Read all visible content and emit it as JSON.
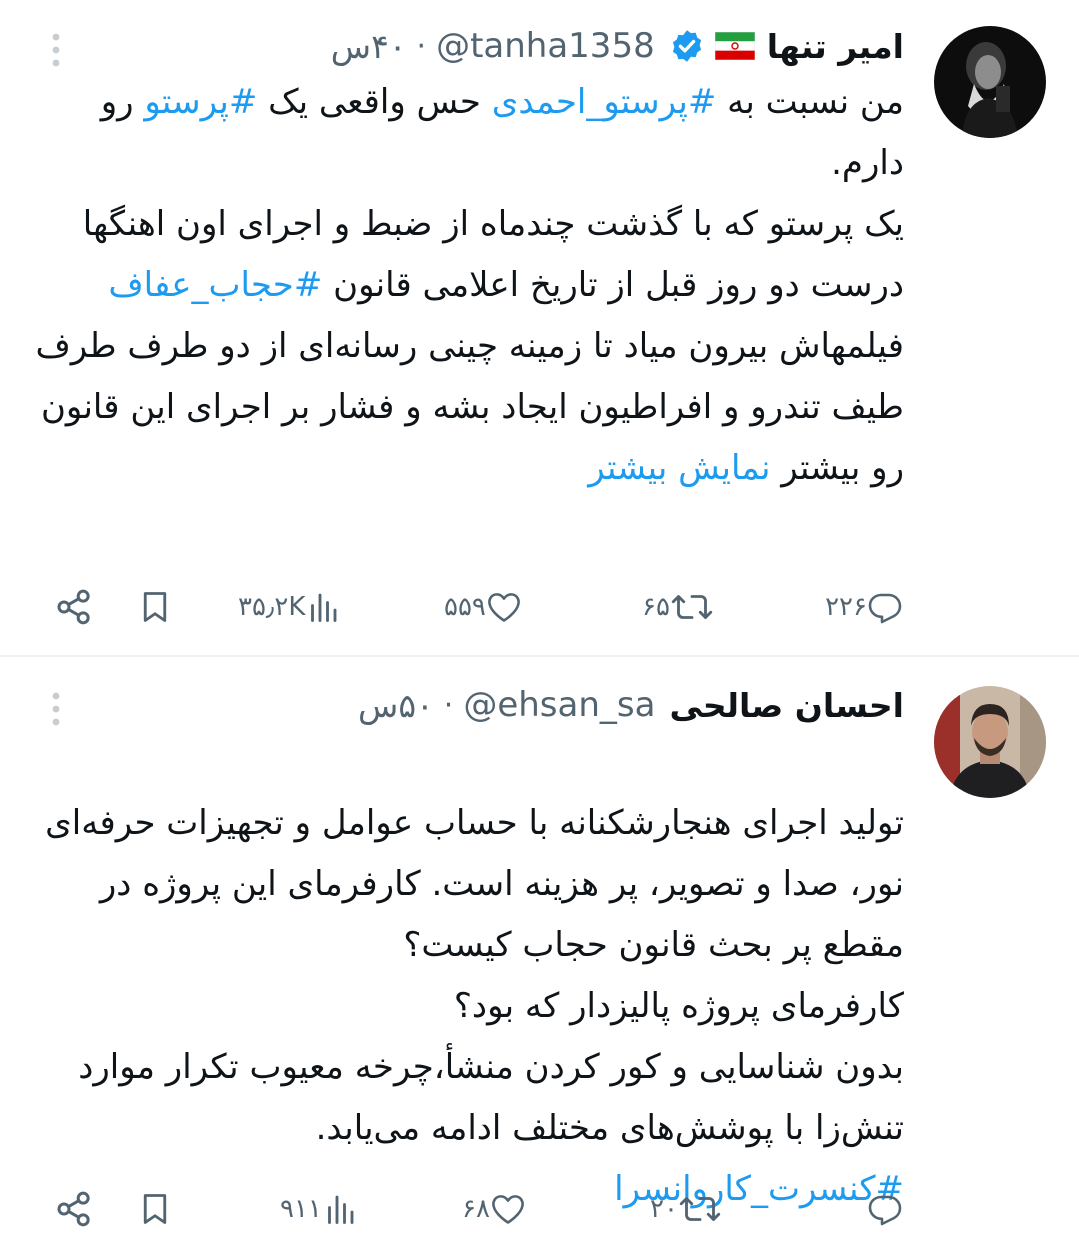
{
  "tweets": [
    {
      "name": "امیر تنها",
      "handle": "@tanha1358",
      "separator": "·",
      "time": "۴۰س",
      "text_parts": [
        {
          "t": "من نسبت به ",
          "link": false
        },
        {
          "t": "#پرستو_احمدی",
          "link": true
        },
        {
          "t": " حس واقعی یک ",
          "link": false
        },
        {
          "t": "#پرستو",
          "link": true
        },
        {
          "t": " رو دارم.",
          "link": false
        },
        {
          "t": "\nیک پرستو که با گذشت چندماه از ضبط و اجرای اون اهنگها درست دو روز قبل از تاریخ اعلامی قانون ",
          "link": false
        },
        {
          "t": "#حجاب_عفاف",
          "link": true
        },
        {
          "t": " فیلمهاش بیرون میاد تا زمینه چینی رسانه‌ای از دو طرف طرف طیف تندرو و  افراطیون ایجاد بشه و فشار بر اجرای این قانون رو بیشتر ",
          "link": false
        },
        {
          "t": "نمایش بیشتر",
          "link": true
        }
      ],
      "stats": {
        "replies": "۲۲۶",
        "retweets": "۶۵",
        "likes": "۵۵۹",
        "views": "۳۵٫۲K"
      },
      "icons": {
        "avatar": "avatar-dark-portrait",
        "flag": "iran-flag-icon",
        "verified": "verified-badge-icon",
        "more": "more-options-icon",
        "reply": "reply-icon",
        "retweet": "retweet-icon",
        "like": "like-icon",
        "views": "views-icon",
        "bookmark": "bookmark-icon",
        "share": "share-icon"
      }
    },
    {
      "name": "احسان صالحی",
      "handle": "@ehsan_sa",
      "separator": "·",
      "time": "۵۰س",
      "text_parts": [
        {
          "t": "تولید اجرای هنجارشکنانه با حساب عوامل و تجهیزات حرفه‌ای نور، صدا و تصویر، پر هزینه است. کارفرمای این پروژه در مقطع پر بحث قانون حجاب کیست؟\nکارفرمای پروژه پالیزدار که بود؟\nبدون شناسایی و کور کردن منشأ،چرخه معیوب تکرار موارد تنش‌زا با پوشش‌های مختلف ادامه می‌یابد.\n",
          "link": false
        },
        {
          "t": "#کنسرت_کاروانسرا",
          "link": true
        }
      ],
      "stats": {
        "replies": "",
        "retweets": "۲۰",
        "likes": "۶۸",
        "views": "۹۱۱"
      },
      "icons": {
        "avatar": "avatar-man-portrait",
        "more": "more-options-icon",
        "reply": "reply-icon",
        "retweet": "retweet-icon",
        "like": "like-icon",
        "views": "views-icon",
        "bookmark": "bookmark-icon",
        "share": "share-icon"
      }
    }
  ],
  "colors": {
    "link": "#1d9bf0",
    "secondary": "#536471",
    "text": "#0f1419",
    "verified": "#1d9bf0",
    "divider": "#eff3f4"
  }
}
